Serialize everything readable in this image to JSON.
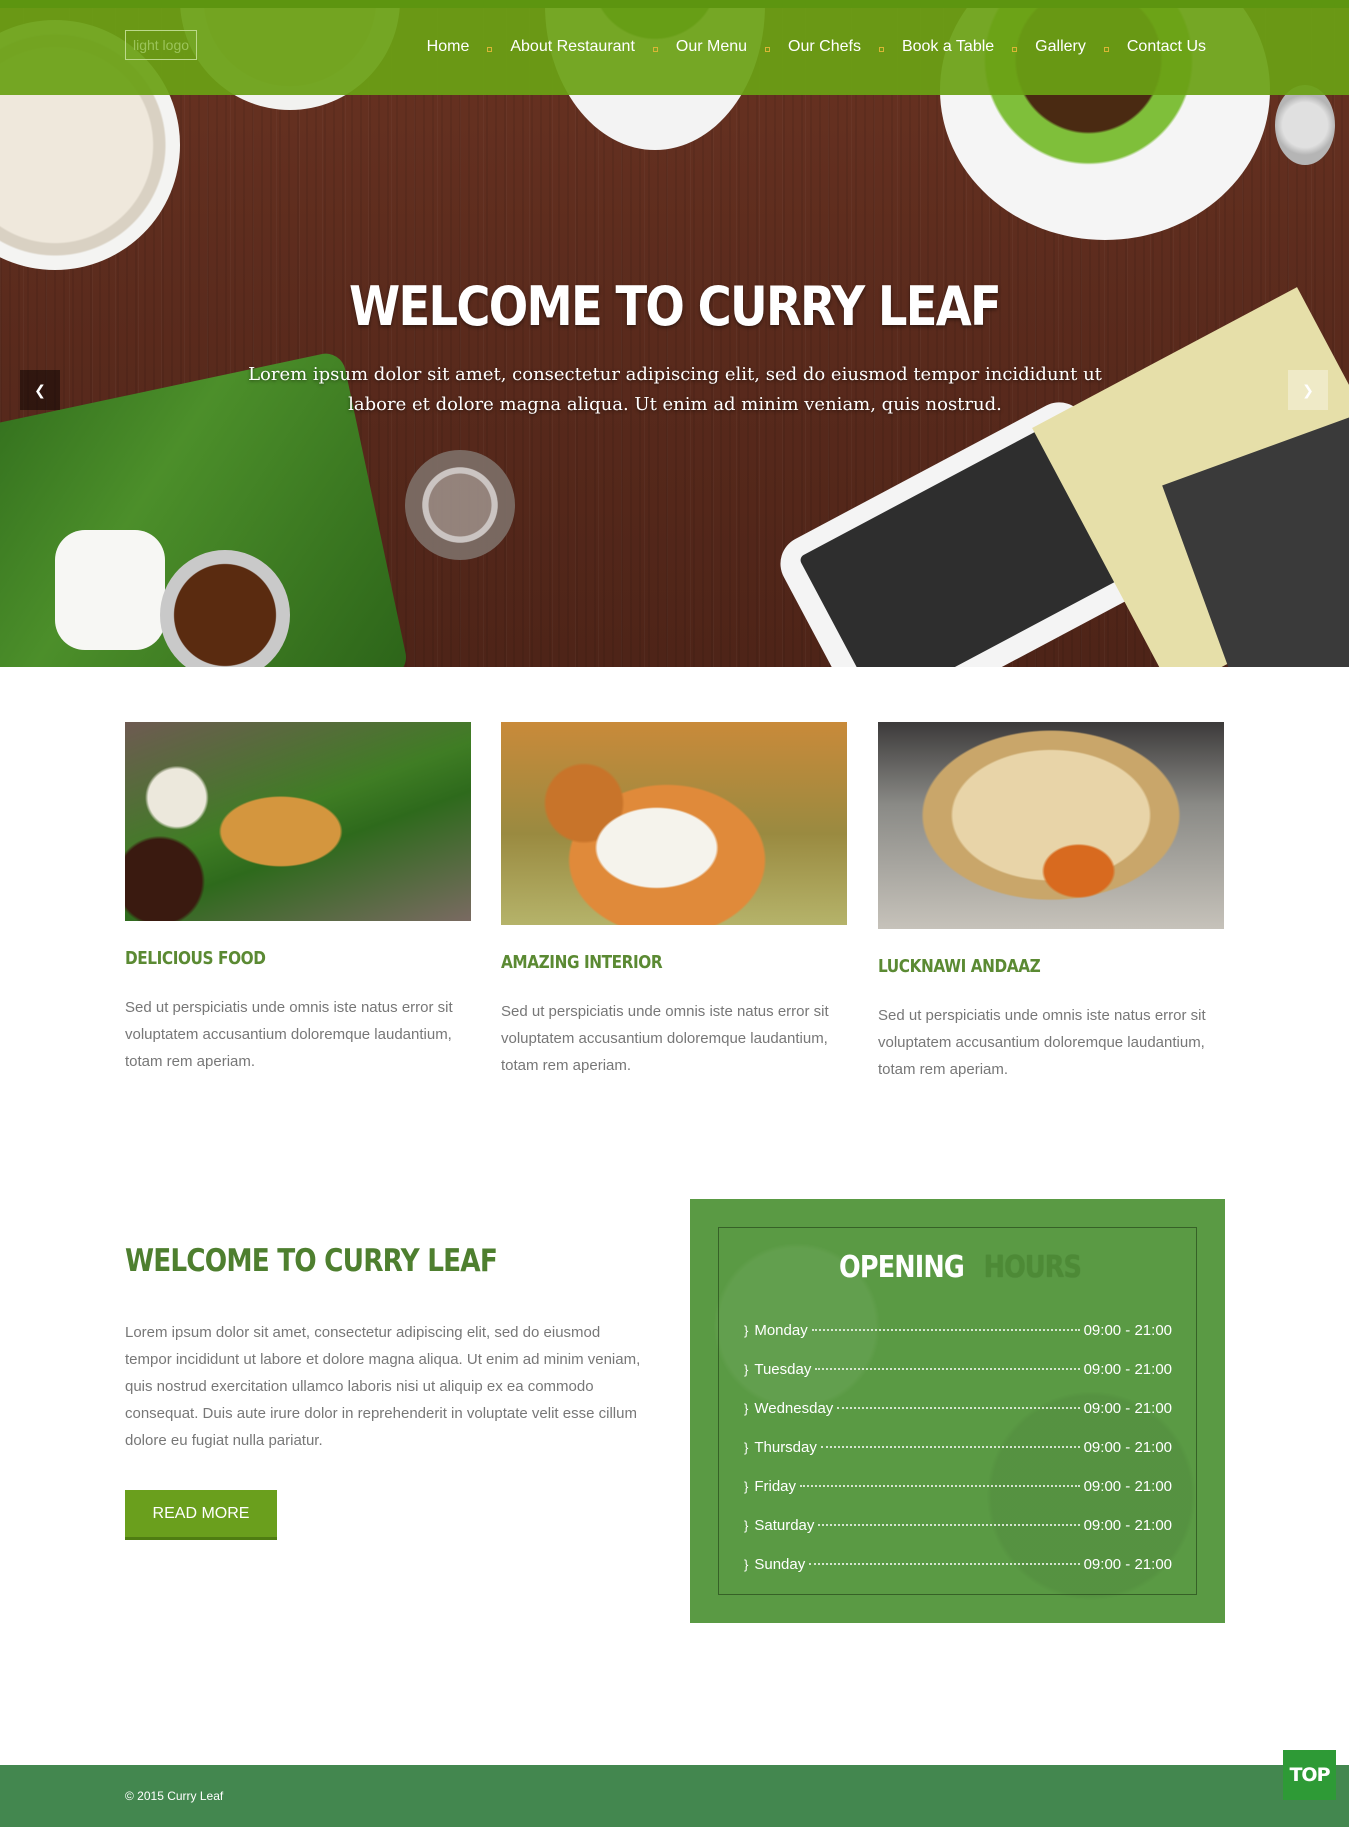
{
  "brand": {
    "logo_alt": "light logo"
  },
  "nav": {
    "items": [
      "Home",
      "About Restaurant",
      "Our Menu",
      "Our Chefs",
      "Book a Table",
      "Gallery",
      "Contact Us"
    ]
  },
  "hero": {
    "title": "WELCOME TO CURRY LEAF",
    "subtitle": "Lorem ipsum dolor sit amet, consectetur adipiscing elit, sed do eiusmod tempor incididunt ut labore et dolore magna aliqua. Ut enim ad minim veniam, quis nostrud.",
    "prev_icon": "prev-arrow-icon",
    "next_icon": "next-arrow-icon"
  },
  "features": [
    {
      "title": "DELICIOUS FOOD",
      "text": "Sed ut perspiciatis unde omnis iste natus error sit voluptatem accusantium doloremque laudantium, totam rem aperiam."
    },
    {
      "title": "AMAZING INTERIOR",
      "text": "Sed ut perspiciatis unde omnis iste natus error sit voluptatem accusantium doloremque laudantium, totam rem aperiam."
    },
    {
      "title": "LUCKNAWI ANDAAZ",
      "text": "Sed ut perspiciatis unde omnis iste natus error sit voluptatem accusantium doloremque laudantium, totam rem aperiam."
    }
  ],
  "welcome": {
    "title": "WELCOME TO CURRY LEAF",
    "text": "Lorem ipsum dolor sit amet, consectetur adipiscing elit, sed do eiusmod tempor incididunt ut labore et dolore magna aliqua. Ut enim ad minim veniam, quis nostrud exercitation ullamco laboris nisi ut aliquip ex ea commodo consequat. Duis aute irure dolor in reprehenderit in voluptate velit esse cillum dolore eu fugiat nulla pariatur.",
    "button": "READ MORE"
  },
  "hours": {
    "title_part1": "OPENING",
    "title_part2": "HOURS",
    "days": [
      {
        "day": "Monday",
        "time": "09:00 - 21:00"
      },
      {
        "day": "Tuesday",
        "time": "09:00 - 21:00"
      },
      {
        "day": "Wednesday",
        "time": "09:00 - 21:00"
      },
      {
        "day": "Thursday",
        "time": "09:00 - 21:00"
      },
      {
        "day": "Friday",
        "time": "09:00 - 21:00"
      },
      {
        "day": "Saturday",
        "time": "09:00 - 21:00"
      },
      {
        "day": "Sunday",
        "time": "09:00 - 21:00"
      }
    ]
  },
  "footer": {
    "copyright": "© 2015 Curry Leaf",
    "top_button": "TOP"
  },
  "colors": {
    "nav_green": "#6aa014",
    "heading_green": "#5b8a33",
    "hours_bg": "#5a9a44",
    "footer_green": "#43874f",
    "button_green": "#6a9f1d",
    "nav_separator": "#d9b635"
  }
}
